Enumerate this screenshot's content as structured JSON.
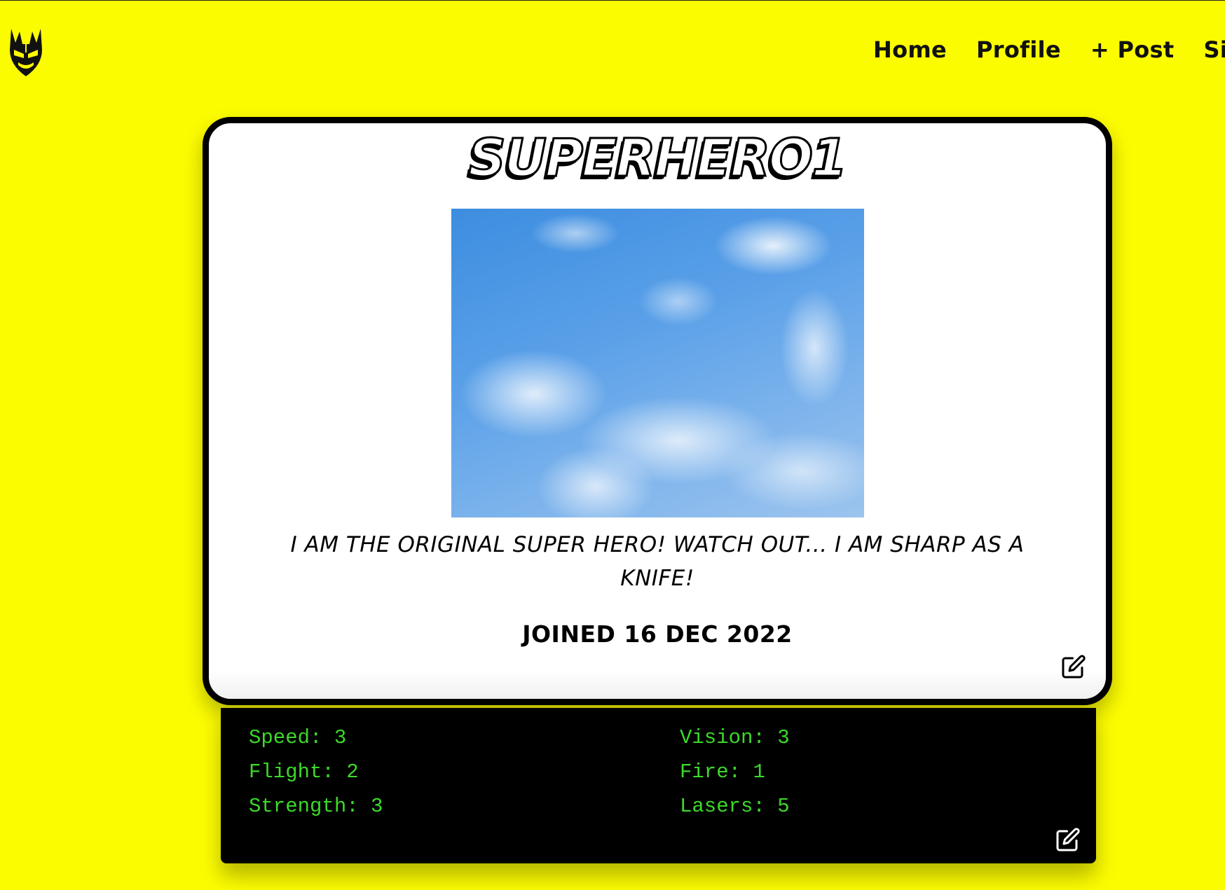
{
  "nav": {
    "links": [
      "Home",
      "Profile",
      "+ Post",
      "Sign out"
    ]
  },
  "profile": {
    "username": "SUPERHERO1",
    "bio": "I am the original super hero! Watch out... I am sharp as a knife!",
    "joined": "JOINED 16 DEC 2022"
  },
  "stats": {
    "left": [
      {
        "label": "Speed",
        "value": "3"
      },
      {
        "label": "Flight",
        "value": "2"
      },
      {
        "label": "Strength",
        "value": "3"
      }
    ],
    "right": [
      {
        "label": "Vision",
        "value": "3"
      },
      {
        "label": "Fire",
        "value": "1"
      },
      {
        "label": "Lasers",
        "value": "5"
      }
    ]
  },
  "colors": {
    "background": "#fcfc00",
    "card": "#ffffff",
    "stats_panel": "#000000",
    "stats_text": "#3cd92a"
  },
  "icons": {
    "logo": "superhero-mask-logo",
    "profile_edit": "edit-icon",
    "stats_edit": "edit-icon"
  }
}
